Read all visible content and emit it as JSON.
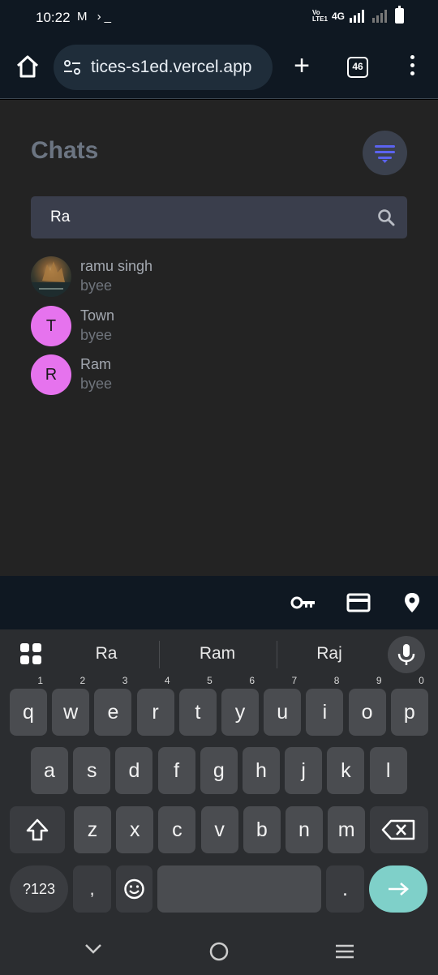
{
  "status": {
    "time": "10:22",
    "left_icons": "M ›_",
    "volte": "Vo LTE1",
    "network": "4G"
  },
  "browser": {
    "url": "tices-s1ed.vercel.app",
    "tab_count": "46",
    "plus_label": "+"
  },
  "app": {
    "title": "Chats",
    "search": {
      "value": "Ra"
    },
    "chats": [
      {
        "name": "ramu singh",
        "last_message": "byee",
        "avatar_letter": ""
      },
      {
        "name": "Town",
        "last_message": "byee",
        "avatar_letter": "T"
      },
      {
        "name": "Ram",
        "last_message": "byee",
        "avatar_letter": "R"
      }
    ]
  },
  "keyboard": {
    "suggestions": [
      "Ra",
      "Ram",
      "Raj"
    ],
    "row1": [
      {
        "k": "q",
        "n": "1"
      },
      {
        "k": "w",
        "n": "2"
      },
      {
        "k": "e",
        "n": "3"
      },
      {
        "k": "r",
        "n": "4"
      },
      {
        "k": "t",
        "n": "5"
      },
      {
        "k": "y",
        "n": "6"
      },
      {
        "k": "u",
        "n": "7"
      },
      {
        "k": "i",
        "n": "8"
      },
      {
        "k": "o",
        "n": "9"
      },
      {
        "k": "p",
        "n": "0"
      }
    ],
    "row2": [
      "a",
      "s",
      "d",
      "f",
      "g",
      "h",
      "j",
      "k",
      "l"
    ],
    "row3": [
      "z",
      "x",
      "c",
      "v",
      "b",
      "n",
      "m"
    ],
    "symbols_label": "?123",
    "comma": ",",
    "period": "."
  },
  "colors": {
    "accent": "#5b63f0",
    "avatar": "#e673ee",
    "enter": "#7fd0c9"
  }
}
